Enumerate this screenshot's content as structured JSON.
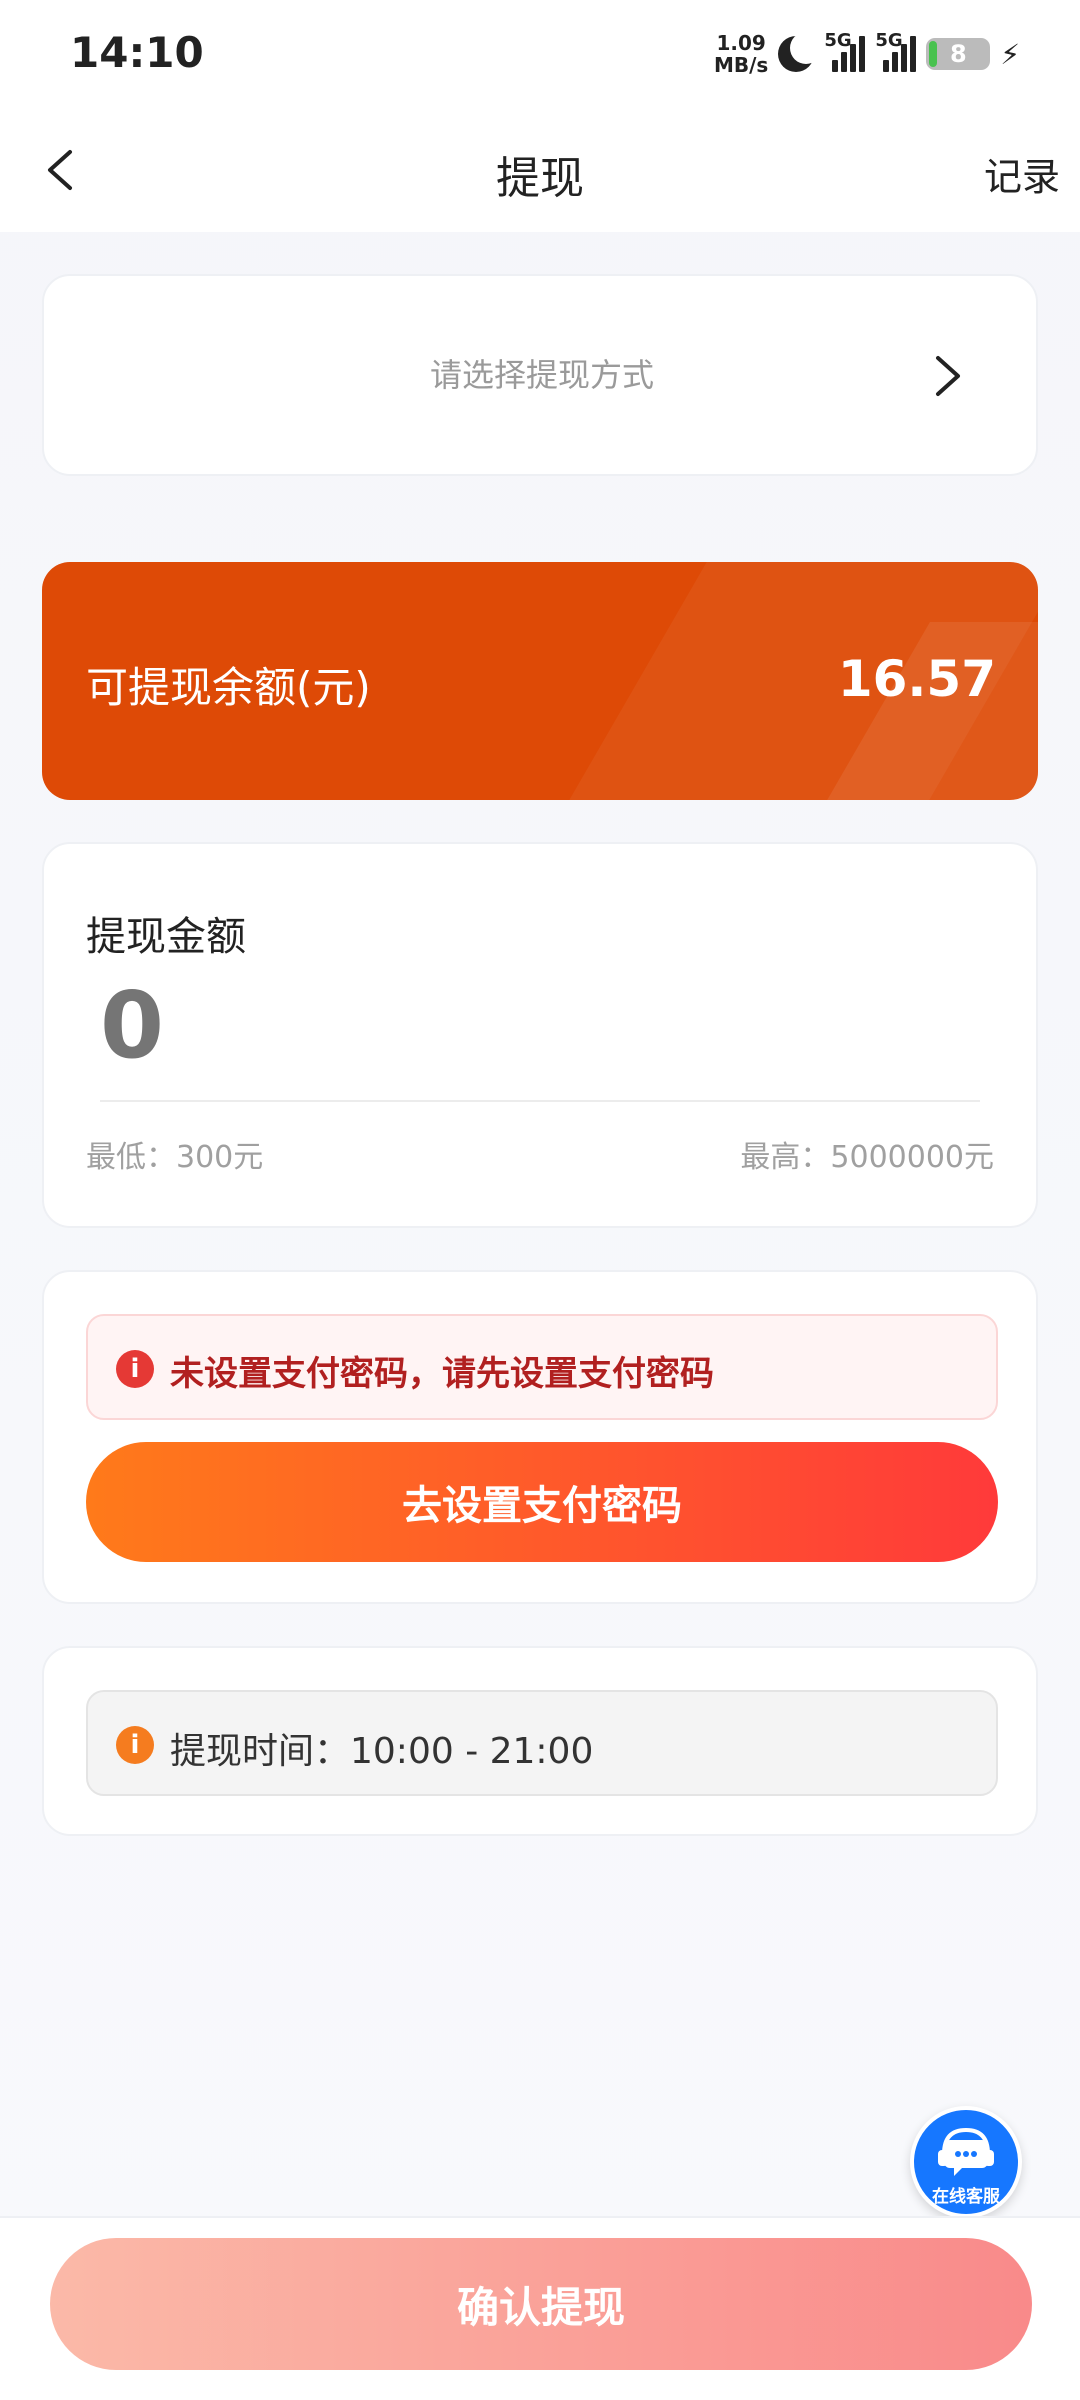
{
  "status_bar": {
    "time": "14:10",
    "net_speed_value": "1.09",
    "net_speed_unit": "MB/s",
    "sim1_label": "5G",
    "sim2_label": "5G",
    "battery_level": "8"
  },
  "nav": {
    "title": "提现",
    "record_label": "记录"
  },
  "method": {
    "placeholder": "请选择提现方式"
  },
  "balance": {
    "label": "可提现余额(元)",
    "value": "16.57"
  },
  "amount": {
    "title": "提现金额",
    "placeholder": "0",
    "min_text": "最低：300元",
    "max_text": "最高：5000000元"
  },
  "password": {
    "alert_text": "未设置支付密码，请先设置支付密码",
    "button_label": "去设置支付密码"
  },
  "withdraw_time": {
    "text": "提现时间：10:00 - 21:00"
  },
  "customer_service": {
    "label": "在线客服"
  },
  "footer": {
    "confirm_label": "确认提现"
  },
  "colors": {
    "balance_bg": "#de4a06",
    "accent_orange": "#ff7a1a",
    "accent_red": "#ff3a3a",
    "cs_blue": "#1677ff"
  }
}
